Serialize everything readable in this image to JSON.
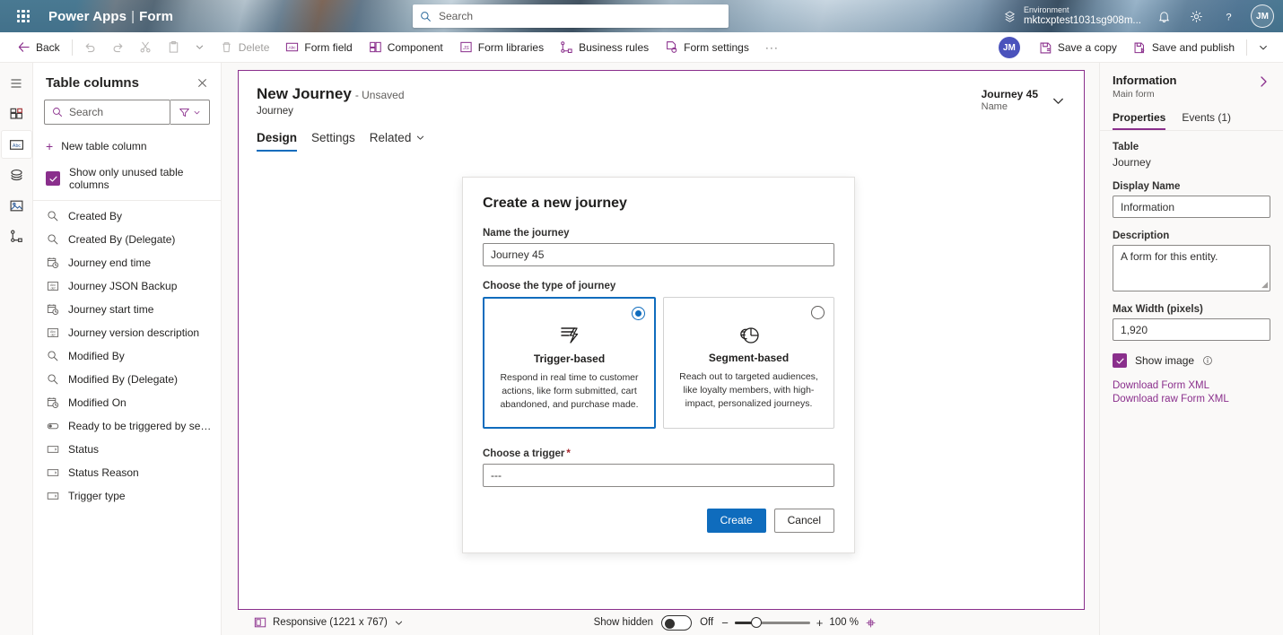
{
  "suitebar": {
    "waffle": "app-launcher",
    "brand": "Power Apps",
    "brand_separator": "|",
    "app_name": "Form",
    "search": {
      "placeholder": "Search"
    },
    "environment_label": "Environment",
    "environment_name": "mktcxptest1031sg908m...",
    "avatar_initials": "JM"
  },
  "commandbar": {
    "back": "Back",
    "delete": "Delete",
    "form_field": "Form field",
    "component": "Component",
    "form_libraries": "Form libraries",
    "business_rules": "Business rules",
    "form_settings": "Form settings",
    "overflow": "···",
    "avatar_initials": "JM",
    "save_a_copy": "Save a copy",
    "save_and_publish": "Save and publish"
  },
  "leftpanel": {
    "title": "Table columns",
    "search_placeholder": "Search",
    "new_column": "New table column",
    "show_unused": "Show only unused table columns",
    "show_unused_checked": true,
    "columns": [
      {
        "label": "Created By",
        "icon": "lookup-icon"
      },
      {
        "label": "Created By (Delegate)",
        "icon": "lookup-icon"
      },
      {
        "label": "Journey end time",
        "icon": "datetime-icon"
      },
      {
        "label": "Journey JSON Backup",
        "icon": "text-icon"
      },
      {
        "label": "Journey start time",
        "icon": "datetime-icon"
      },
      {
        "label": "Journey version description",
        "icon": "text-icon"
      },
      {
        "label": "Modified By",
        "icon": "lookup-icon"
      },
      {
        "label": "Modified By (Delegate)",
        "icon": "lookup-icon"
      },
      {
        "label": "Modified On",
        "icon": "datetime-icon"
      },
      {
        "label": "Ready to be triggered by segment r...",
        "icon": "toggle-icon"
      },
      {
        "label": "Status",
        "icon": "choice-icon"
      },
      {
        "label": "Status Reason",
        "icon": "choice-icon"
      },
      {
        "label": "Trigger type",
        "icon": "choice-icon"
      }
    ]
  },
  "form": {
    "title": "New Journey",
    "unsaved": "- Unsaved",
    "subtitle": "Journey",
    "record_value": "Journey 45",
    "record_key": "Name",
    "tabs": [
      {
        "label": "Design",
        "active": true,
        "chevron": false
      },
      {
        "label": "Settings",
        "active": false,
        "chevron": false
      },
      {
        "label": "Related",
        "active": false,
        "chevron": true
      }
    ]
  },
  "dialog": {
    "title": "Create a new journey",
    "name_label": "Name the journey",
    "name_value": "Journey 45",
    "type_label": "Choose the type of journey",
    "cards": [
      {
        "title": "Trigger-based",
        "desc": "Respond in real time to customer actions, like form submitted, cart abandoned, and purchase made.",
        "icon": "trigger-icon",
        "selected": true
      },
      {
        "title": "Segment-based",
        "desc": "Reach out to targeted audiences, like loyalty members, with high-impact, personalized journeys.",
        "icon": "segment-icon",
        "selected": false
      }
    ],
    "trigger_label": "Choose a trigger",
    "trigger_required": "*",
    "trigger_value": "---",
    "create_label": "Create",
    "cancel_label": "Cancel"
  },
  "statusbar": {
    "layout": "Responsive (1221 x 767)",
    "show_hidden_label": "Show hidden",
    "show_hidden_state": "Off",
    "zoom_minus": "−",
    "zoom_plus": "+",
    "zoom_level": "100 %"
  },
  "rightpanel": {
    "title": "Information",
    "subtitle": "Main form",
    "tabs": [
      {
        "label": "Properties",
        "active": true
      },
      {
        "label": "Events (1)",
        "active": false
      }
    ],
    "table_label": "Table",
    "table_value": "Journey",
    "display_name_label": "Display Name",
    "display_name_value": "Information",
    "description_label": "Description",
    "description_value": "A form for this entity.",
    "max_width_label": "Max Width (pixels)",
    "max_width_value": "1,920",
    "show_image_label": "Show image",
    "show_image_checked": true,
    "download_form_xml": "Download Form XML",
    "download_raw_form_xml": "Download raw Form XML"
  },
  "colors": {
    "brand_purple": "#8a2f8c",
    "accent_blue": "#0f6cbd",
    "suitebar": "#4a7a94",
    "required_red": "#a4262c"
  }
}
